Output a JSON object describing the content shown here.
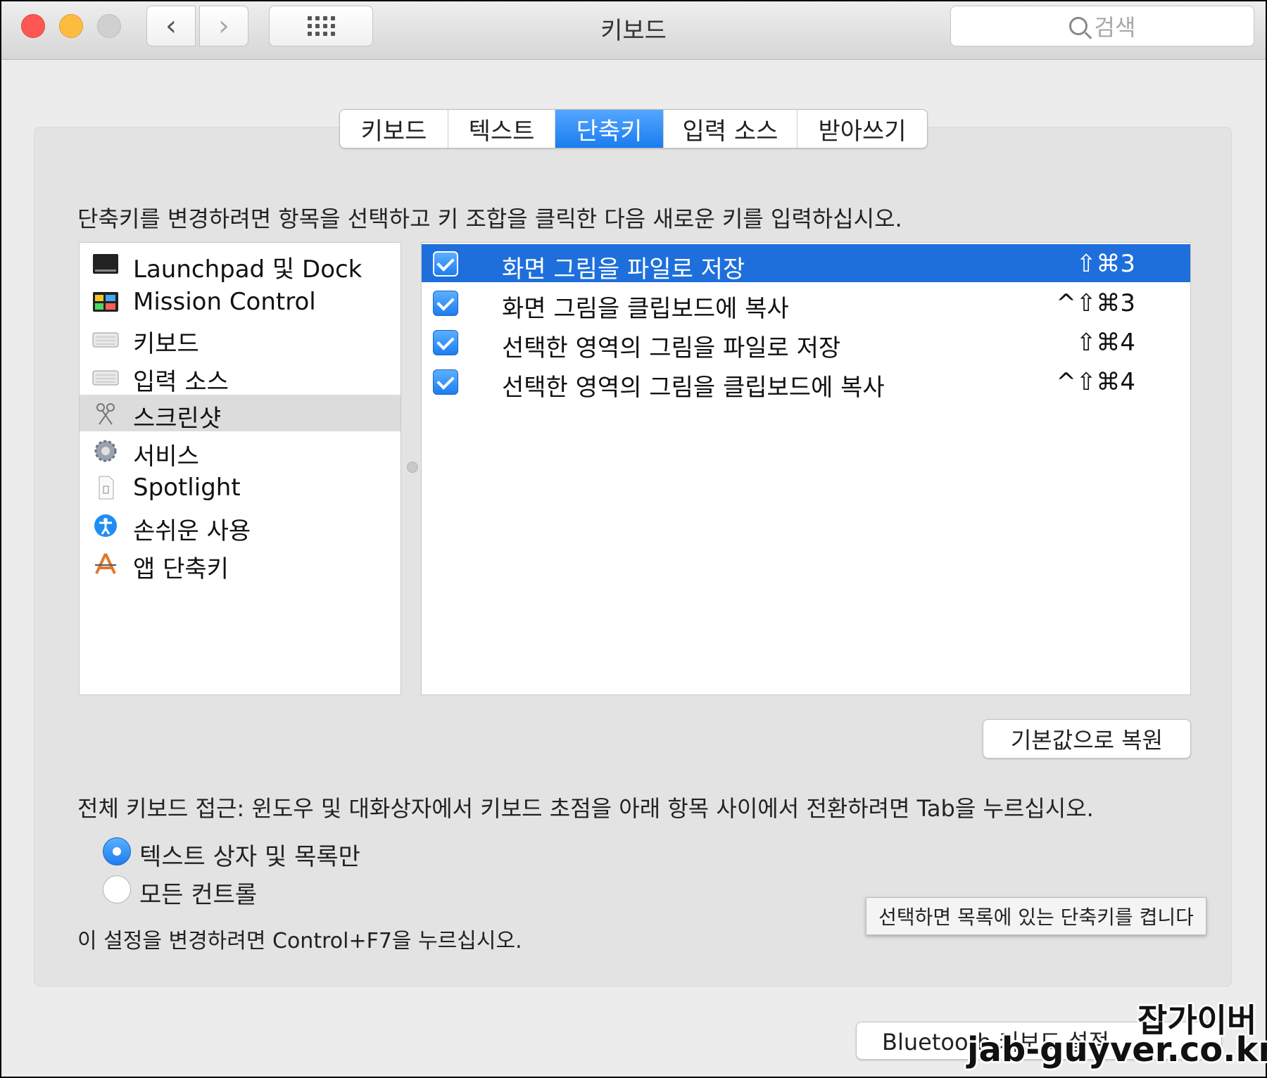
{
  "window": {
    "title": "키보드",
    "search_placeholder": "검색"
  },
  "tabs": [
    {
      "label": "키보드",
      "active": false
    },
    {
      "label": "텍스트",
      "active": false
    },
    {
      "label": "단축키",
      "active": true
    },
    {
      "label": "입력 소스",
      "active": false
    },
    {
      "label": "받아쓰기",
      "active": false
    }
  ],
  "instruction": "단축키를 변경하려면 항목을 선택하고 키 조합을 클릭한 다음 새로운 키를 입력하십시오.",
  "categories": [
    {
      "label": "Launchpad 및 Dock",
      "icon": "launchpad-dock-icon",
      "selected": false
    },
    {
      "label": "Mission Control",
      "icon": "mission-control-icon",
      "selected": false
    },
    {
      "label": "키보드",
      "icon": "keyboard-icon",
      "selected": false
    },
    {
      "label": "입력 소스",
      "icon": "keyboard-icon",
      "selected": false
    },
    {
      "label": "스크린샷",
      "icon": "screenshot-icon",
      "selected": true
    },
    {
      "label": "서비스",
      "icon": "gear-icon",
      "selected": false
    },
    {
      "label": "Spotlight",
      "icon": "document-icon",
      "selected": false
    },
    {
      "label": "손쉬운 사용",
      "icon": "accessibility-icon",
      "selected": false
    },
    {
      "label": "앱 단축키",
      "icon": "app-store-icon",
      "selected": false
    }
  ],
  "shortcuts": [
    {
      "label": "화면 그림을 파일로 저장",
      "keys": "⇧⌘3",
      "checked": true,
      "selected": true
    },
    {
      "label": "화면 그림을 클립보드에 복사",
      "keys": "^⇧⌘3",
      "checked": true,
      "selected": false
    },
    {
      "label": "선택한 영역의 그림을 파일로 저장",
      "keys": "⇧⌘4",
      "checked": true,
      "selected": false
    },
    {
      "label": "선택한 영역의 그림을 클립보드에 복사",
      "keys": "^⇧⌘4",
      "checked": true,
      "selected": false
    }
  ],
  "restore_button": "기본값으로 복원",
  "keyboard_access": "전체 키보드 접근: 윈도우 및 대화상자에서 키보드 초점을 아래 항목 사이에서 전환하려면 Tab을 누르십시오.",
  "radio_options": [
    {
      "label": "텍스트 상자 및 목록만",
      "selected": true
    },
    {
      "label": "모든 컨트롤",
      "selected": false
    }
  ],
  "note": "이 설정을 변경하려면 Control+F7을 누르십시오.",
  "tooltip": "선택하면 목록에 있는 단축키를 켭니다",
  "bluetooth_button": "Bluetooth 키보드 설정",
  "watermark": {
    "line1": "잡가이버",
    "line2": "jab-guyver.co.kr"
  },
  "colors": {
    "accent": "#1e6fdc",
    "close": "#fc5753",
    "minimize": "#fdbc40"
  }
}
